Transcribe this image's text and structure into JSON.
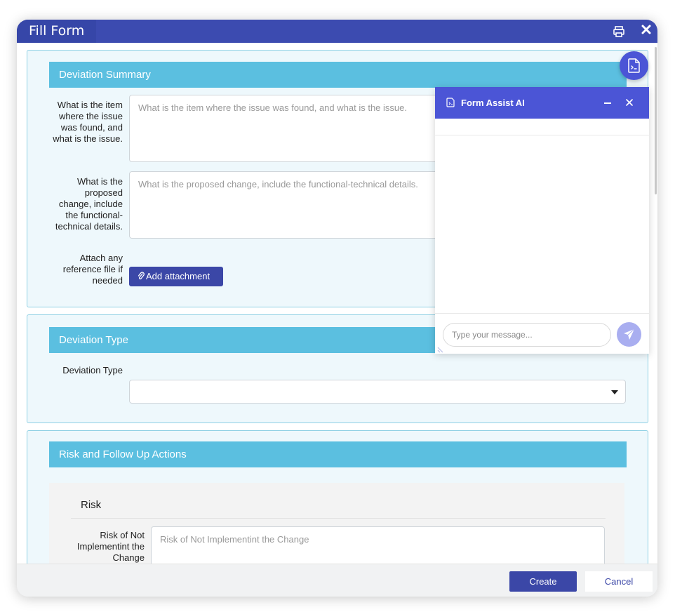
{
  "window": {
    "title": "Fill Form"
  },
  "sections": {
    "deviation_summary": {
      "header": "Deviation Summary",
      "issue_label_lines": [
        "What is the item",
        "where the issue",
        "was found, and",
        "what is the issue."
      ],
      "issue_placeholder": "What is the item where the issue was found, and what is the issue.",
      "change_label_lines": [
        "What is the",
        "proposed",
        "change, include",
        "the functional-",
        "technical details."
      ],
      "change_placeholder": "What is the proposed change, include the functional-technical details.",
      "attach_label_lines": [
        "Attach any",
        "reference file if",
        "needed"
      ],
      "attach_button": "Add attachment"
    },
    "deviation_type": {
      "header": "Deviation Type",
      "label": "Deviation Type",
      "selected": ""
    },
    "risk": {
      "header": "Risk and Follow Up Actions",
      "card_title": "Risk",
      "risk_label_lines": [
        "Risk of Not",
        "Implementint the",
        "Change"
      ],
      "risk_placeholder": "Risk of Not Implementint the Change"
    }
  },
  "footer": {
    "create": "Create",
    "cancel": "Cancel"
  },
  "assistant": {
    "title": "Form Assist AI",
    "input_placeholder": "Type your message...",
    "icons": [
      "form-assist-icon",
      "minimize-icon",
      "close-icon",
      "send-icon"
    ]
  },
  "colors": {
    "titlebar": "#3c4bb0",
    "section_header": "#5bbfe0",
    "panel_bg": "#eef8fc",
    "primary_button": "#3b47a7",
    "assistant_accent": "#4b55d6"
  }
}
